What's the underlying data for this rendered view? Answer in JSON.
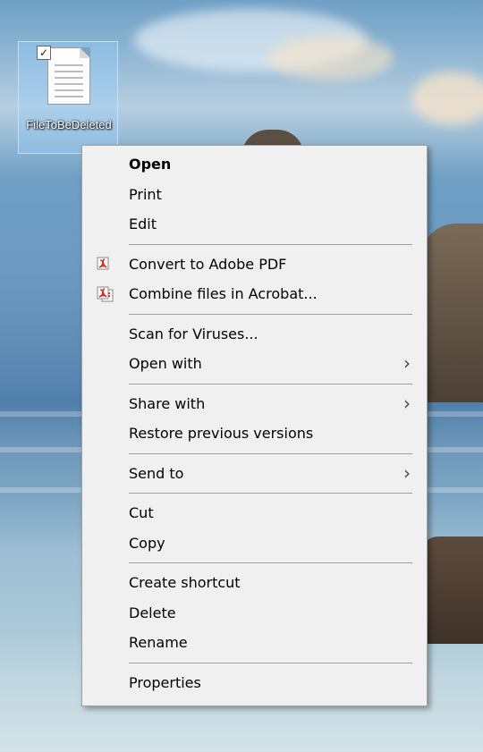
{
  "desktop": {
    "file_icon": {
      "label": "FileToBeDeleted",
      "checked_glyph": "✓",
      "icon": "document-icon"
    }
  },
  "context_menu": {
    "groups": [
      [
        {
          "label": "Open",
          "bold": true
        },
        {
          "label": "Print"
        },
        {
          "label": "Edit"
        }
      ],
      [
        {
          "label": "Convert to Adobe PDF",
          "icon": "adobe-pdf-icon"
        },
        {
          "label": "Combine files in Acrobat...",
          "icon": "acrobat-combine-icon"
        }
      ],
      [
        {
          "label": "Scan for Viruses..."
        },
        {
          "label": "Open with",
          "submenu": true
        }
      ],
      [
        {
          "label": "Share with",
          "submenu": true
        },
        {
          "label": "Restore previous versions"
        }
      ],
      [
        {
          "label": "Send to",
          "submenu": true
        }
      ],
      [
        {
          "label": "Cut"
        },
        {
          "label": "Copy"
        }
      ],
      [
        {
          "label": "Create shortcut"
        },
        {
          "label": "Delete"
        },
        {
          "label": "Rename"
        }
      ],
      [
        {
          "label": "Properties"
        }
      ]
    ],
    "submenu_arrow": "›",
    "colors": {
      "background": "#f0f0f0",
      "separator": "#a0a0a0",
      "pdf_red": "#d22b2b"
    }
  }
}
